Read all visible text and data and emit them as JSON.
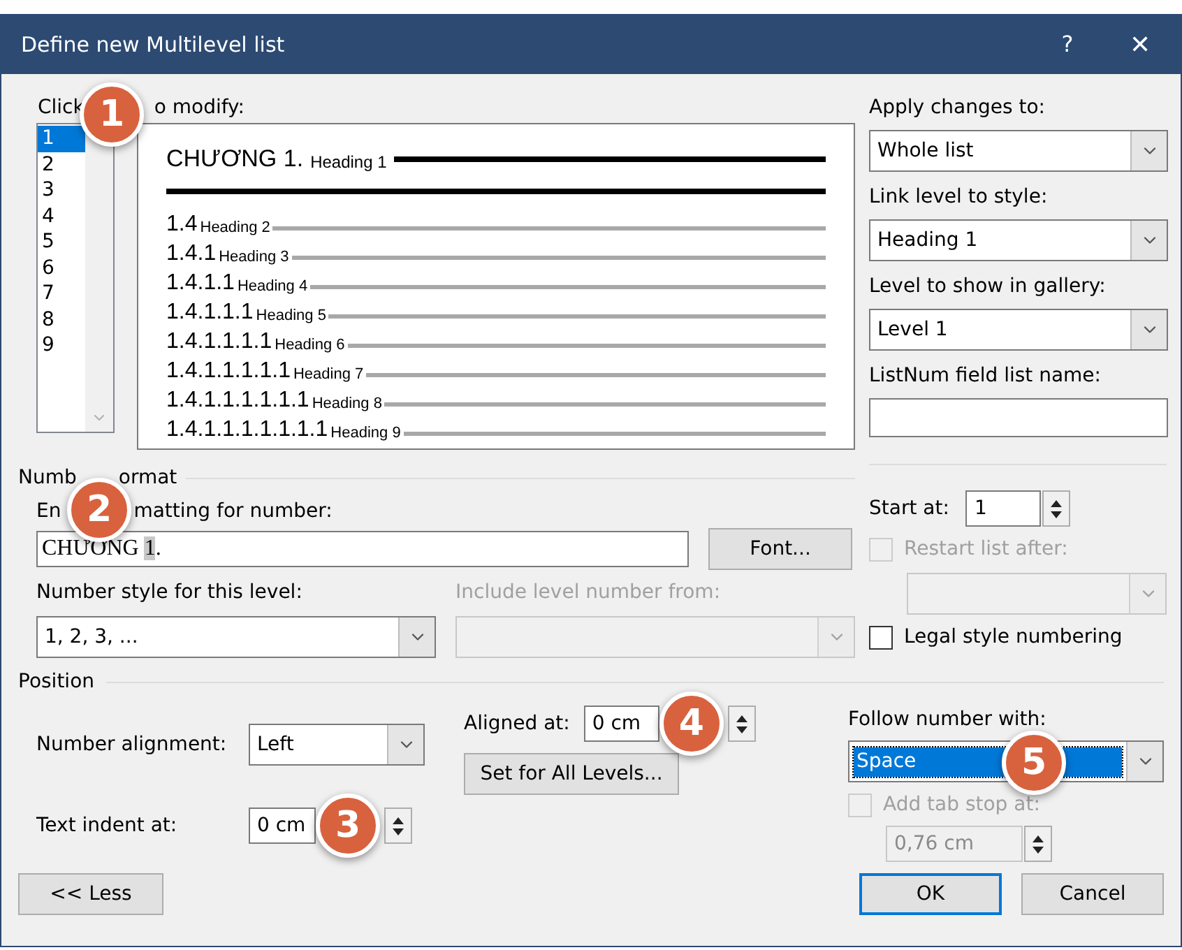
{
  "window": {
    "title": "Define new Multilevel list",
    "help": "?",
    "close": "✕"
  },
  "levels_label": [
    "Click",
    "o modify:"
  ],
  "levels": [
    {
      "label": "1",
      "selected": true
    },
    {
      "label": "2",
      "selected": false
    },
    {
      "label": "3",
      "selected": false
    },
    {
      "label": "4",
      "selected": false
    },
    {
      "label": "5",
      "selected": false
    },
    {
      "label": "6",
      "selected": false
    },
    {
      "label": "7",
      "selected": false
    },
    {
      "label": "8",
      "selected": false
    },
    {
      "label": "9",
      "selected": false
    }
  ],
  "preview": [
    {
      "kind": "main",
      "number": "CHƯƠNG 1.",
      "style": "Heading 1"
    },
    {
      "kind": "sub",
      "number": "1.4",
      "style": "Heading 2"
    },
    {
      "kind": "sub",
      "number": "1.4.1",
      "style": "Heading 3"
    },
    {
      "kind": "sub",
      "number": "1.4.1.1",
      "style": "Heading 4"
    },
    {
      "kind": "sub",
      "number": "1.4.1.1.1",
      "style": "Heading 5"
    },
    {
      "kind": "sub",
      "number": "1.4.1.1.1.1",
      "style": "Heading 6"
    },
    {
      "kind": "sub",
      "number": "1.4.1.1.1.1.1",
      "style": "Heading 7"
    },
    {
      "kind": "sub",
      "number": "1.4.1.1.1.1.1.1",
      "style": "Heading 8"
    },
    {
      "kind": "sub",
      "number": "1.4.1.1.1.1.1.1.1",
      "style": "Heading 9"
    }
  ],
  "apply_changes": {
    "label": "Apply changes to:",
    "value": "Whole list"
  },
  "link_level": {
    "label": "Link level to style:",
    "value": "Heading 1"
  },
  "gallery_level": {
    "label": "Level to show in gallery:",
    "value": "Level 1"
  },
  "listnum": {
    "label": "ListNum field list name:"
  },
  "number_format": {
    "heading": [
      "Numb",
      "ormat"
    ],
    "formatting_label": [
      "En",
      "matting for number:"
    ],
    "formatting_value": {
      "before": "CHƯƠNG ",
      "number": "1",
      "after": "."
    },
    "font_button": "Font...",
    "style_label": "Number style for this level:",
    "style_value": "1, 2, 3, ...",
    "include_label": "Include level number from:",
    "include_disabled": true,
    "start_at": {
      "label": "Start at:",
      "value": "1"
    },
    "restart": {
      "label": "Restart list after:",
      "checked": false,
      "disabled": true
    },
    "legal": {
      "label": "Legal style numbering",
      "checked": false
    }
  },
  "position": {
    "heading": "Position",
    "alignment": {
      "label": "Number alignment:",
      "value": "Left"
    },
    "aligned_at": {
      "label": "Aligned at:",
      "value": "0 cm"
    },
    "indent": {
      "label": "Text indent at:",
      "value": "0 cm"
    },
    "set_all": "Set for All Levels...",
    "follow": {
      "label": "Follow number with:",
      "value": "Space",
      "selected": true
    },
    "tab_stop": {
      "label": "Add tab stop at:",
      "checked": false,
      "disabled": true,
      "value": "0,76 cm"
    }
  },
  "callouts": [
    "1",
    "2",
    "3",
    "4",
    "5"
  ],
  "buttons": {
    "less": "<< Less",
    "ok": "OK",
    "cancel": "Cancel"
  }
}
